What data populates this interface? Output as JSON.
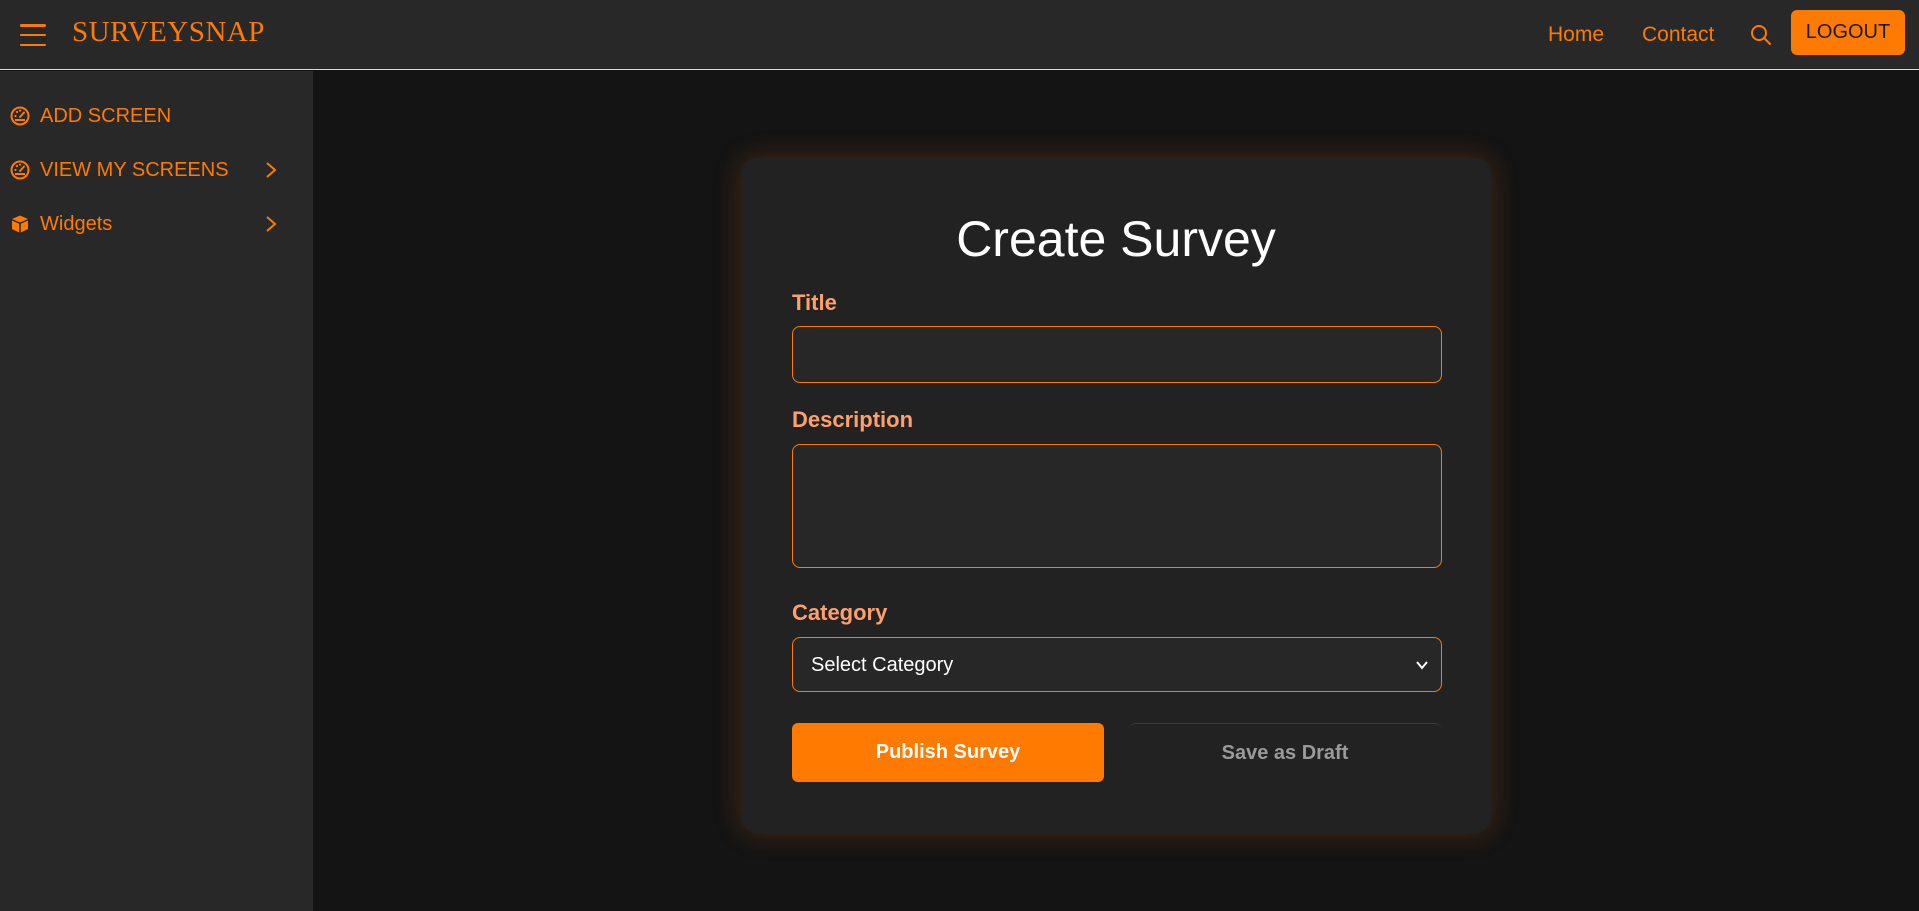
{
  "header": {
    "brand": "SURVEYSNAP",
    "menu_icon": "hamburger-menu-icon",
    "nav": [
      {
        "label": "Home"
      },
      {
        "label": "Contact"
      }
    ],
    "search_icon": "search-icon",
    "logout_label": "LOGOUT"
  },
  "sidebar": {
    "items": [
      {
        "label": "ADD SCREEN",
        "icon": "dashboard-gauge-icon",
        "has_chevron": false
      },
      {
        "label": "VIEW MY SCREENS",
        "icon": "dashboard-gauge-icon",
        "has_chevron": true
      },
      {
        "label": "Widgets",
        "icon": "box-icon",
        "has_chevron": true
      }
    ]
  },
  "form": {
    "title": "Create Survey",
    "fields": {
      "title_label": "Title",
      "title_value": "",
      "description_label": "Description",
      "description_value": "",
      "category_label": "Category",
      "category_selected": "Select Category"
    },
    "publish_label": "Publish Survey",
    "draft_label": "Save as Draft"
  },
  "colors": {
    "accent": "#ff7a00",
    "label": "#ff9f6b",
    "background": "#141414",
    "panel": "#282828",
    "card": "#222222"
  }
}
